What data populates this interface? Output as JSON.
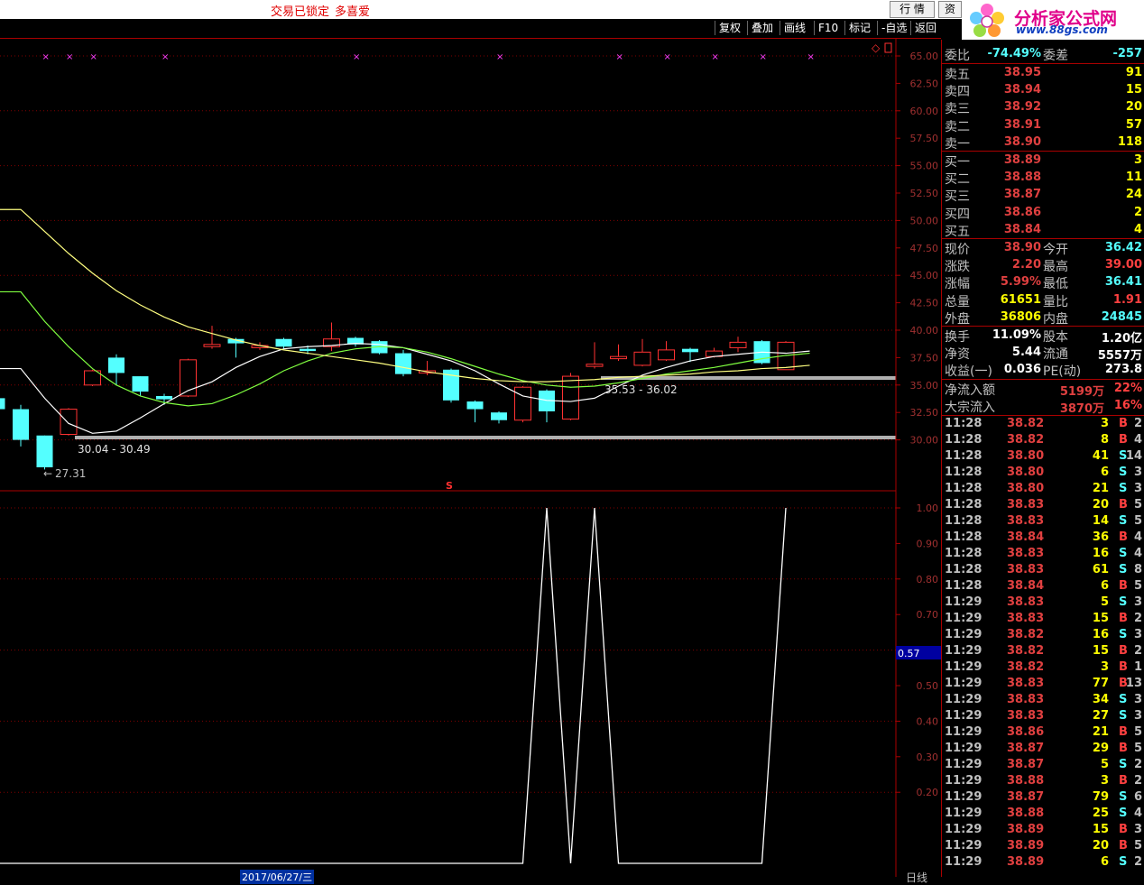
{
  "topbar": {
    "lock_text": "交易已锁定",
    "user_text": "多喜爱",
    "btn_quote": "行 情",
    "btn_info": "资"
  },
  "logo": {
    "title": "分析家公式网",
    "url": "www.88gs.com"
  },
  "toolbar": [
    "复权",
    "叠加",
    "画线",
    "F10",
    "标记",
    "-自选",
    "返回"
  ],
  "chart": {
    "price_ticks": [
      "65.00",
      "62.50",
      "60.00",
      "57.50",
      "55.00",
      "52.50",
      "50.00",
      "47.50",
      "45.00",
      "42.50",
      "40.00",
      "37.50",
      "35.00",
      "32.50",
      "30.00"
    ],
    "indicator_ticks": [
      "1.00",
      "0.90",
      "0.80",
      "0.70",
      "0.60",
      "0.50",
      "0.40",
      "0.30",
      "0.20"
    ],
    "indicator_current": "0.57",
    "annot_low": "27.31",
    "annot_range1": "30.04 - 30.49",
    "annot_range2": "35.53 - 36.02",
    "marker_s": "S",
    "bottom_date": "2017/06/27/三",
    "bottom_label": "日线",
    "colors": {
      "up": "#ff3232",
      "down": "#54ffff",
      "ma_white": "#ffffff",
      "ma_yellow": "#ffff80",
      "ma_green": "#80ff40",
      "grid": "#800000"
    }
  },
  "quote": {
    "wei_bi_label": "委比",
    "wei_bi": "-74.49%",
    "wei_cha_label": "委差",
    "wei_cha": "-257",
    "asks": [
      {
        "label": "卖五",
        "price": "38.95",
        "vol": "91"
      },
      {
        "label": "卖四",
        "price": "38.94",
        "vol": "15"
      },
      {
        "label": "卖三",
        "price": "38.92",
        "vol": "20"
      },
      {
        "label": "卖二",
        "price": "38.91",
        "vol": "57"
      },
      {
        "label": "卖一",
        "price": "38.90",
        "vol": "118"
      }
    ],
    "bids": [
      {
        "label": "买一",
        "price": "38.89",
        "vol": "3"
      },
      {
        "label": "买二",
        "price": "38.88",
        "vol": "11"
      },
      {
        "label": "买三",
        "price": "38.87",
        "vol": "24"
      },
      {
        "label": "买四",
        "price": "38.86",
        "vol": "2"
      },
      {
        "label": "买五",
        "price": "38.84",
        "vol": "4"
      }
    ],
    "stats1": [
      {
        "l1": "现价",
        "v1": "38.90",
        "l2": "今开",
        "v2": "36.42",
        "c2": "#54ffff"
      },
      {
        "l1": "涨跌",
        "v1": "2.20",
        "l2": "最高",
        "v2": "39.00",
        "c2": "#ff4040"
      },
      {
        "l1": "涨幅",
        "v1": "5.99%",
        "l2": "最低",
        "v2": "36.41",
        "c2": "#54ffff"
      },
      {
        "l1": "总量",
        "v1": "61651",
        "l2": "量比",
        "v2": "1.91",
        "c2": "#ff4040",
        "c1": "#ffff00"
      },
      {
        "l1": "外盘",
        "v1": "36806",
        "l2": "内盘",
        "v2": "24845",
        "c2": "#54ffff",
        "c1": "#ffff00"
      }
    ],
    "stats2": [
      {
        "l1": "换手",
        "v1": "11.09%",
        "l2": "股本",
        "v2": "1.20亿"
      },
      {
        "l1": "净资",
        "v1": "5.44",
        "l2": "流通",
        "v2": "5557万"
      },
      {
        "l1": "收益(一)",
        "v1": "0.036",
        "l2": "PE(动)",
        "v2": "273.8"
      }
    ],
    "flow": [
      {
        "label": "净流入额",
        "value": "5199万",
        "pct": "22%"
      },
      {
        "label": "大宗流入",
        "value": "3870万",
        "pct": "16%"
      }
    ]
  },
  "ticks": [
    [
      "11:28",
      "38.82",
      "3",
      "B",
      "2"
    ],
    [
      "11:28",
      "38.82",
      "8",
      "B",
      "4"
    ],
    [
      "11:28",
      "38.80",
      "41",
      "S",
      "14"
    ],
    [
      "11:28",
      "38.80",
      "6",
      "S",
      "3"
    ],
    [
      "11:28",
      "38.80",
      "21",
      "S",
      "3"
    ],
    [
      "11:28",
      "38.83",
      "20",
      "B",
      "5"
    ],
    [
      "11:28",
      "38.83",
      "14",
      "S",
      "5"
    ],
    [
      "11:28",
      "38.84",
      "36",
      "B",
      "4"
    ],
    [
      "11:28",
      "38.83",
      "16",
      "S",
      "4"
    ],
    [
      "11:28",
      "38.83",
      "61",
      "S",
      "8"
    ],
    [
      "11:28",
      "38.84",
      "6",
      "B",
      "5"
    ],
    [
      "11:29",
      "38.83",
      "5",
      "S",
      "3"
    ],
    [
      "11:29",
      "38.83",
      "15",
      "B",
      "2"
    ],
    [
      "11:29",
      "38.82",
      "16",
      "S",
      "3"
    ],
    [
      "11:29",
      "38.82",
      "15",
      "B",
      "2"
    ],
    [
      "11:29",
      "38.82",
      "3",
      "B",
      "1"
    ],
    [
      "11:29",
      "38.83",
      "77",
      "B",
      "13"
    ],
    [
      "11:29",
      "38.83",
      "34",
      "S",
      "3"
    ],
    [
      "11:29",
      "38.83",
      "27",
      "S",
      "3"
    ],
    [
      "11:29",
      "38.86",
      "21",
      "B",
      "5"
    ],
    [
      "11:29",
      "38.87",
      "29",
      "B",
      "5"
    ],
    [
      "11:29",
      "38.87",
      "5",
      "S",
      "2"
    ],
    [
      "11:29",
      "38.88",
      "3",
      "B",
      "2"
    ],
    [
      "11:29",
      "38.87",
      "79",
      "S",
      "6"
    ],
    [
      "11:29",
      "38.88",
      "25",
      "S",
      "4"
    ],
    [
      "11:29",
      "38.89",
      "15",
      "B",
      "3"
    ],
    [
      "11:29",
      "38.89",
      "20",
      "B",
      "5"
    ],
    [
      "11:29",
      "38.89",
      "6",
      "S",
      "2"
    ]
  ],
  "candles": [
    {
      "o": 33.8,
      "c": 32.8,
      "h": 34.0,
      "l": 32.5
    },
    {
      "o": 32.8,
      "c": 30.0,
      "h": 33.2,
      "l": 29.4
    },
    {
      "o": 30.4,
      "c": 27.5,
      "h": 30.4,
      "l": 27.3
    },
    {
      "o": 30.5,
      "c": 32.8,
      "h": 32.9,
      "l": 30.4
    },
    {
      "o": 35.0,
      "c": 36.3,
      "h": 36.4,
      "l": 34.9
    },
    {
      "o": 37.5,
      "c": 36.1,
      "h": 37.8,
      "l": 35.0
    },
    {
      "o": 35.8,
      "c": 34.4,
      "h": 35.8,
      "l": 34.0
    },
    {
      "o": 34.0,
      "c": 33.7,
      "h": 34.2,
      "l": 33.2
    },
    {
      "o": 34.0,
      "c": 37.3,
      "h": 37.4,
      "l": 33.9
    },
    {
      "o": 38.5,
      "c": 38.7,
      "h": 40.4,
      "l": 38.3
    },
    {
      "o": 39.2,
      "c": 38.8,
      "h": 39.3,
      "l": 37.5
    },
    {
      "o": 38.4,
      "c": 38.6,
      "h": 38.9,
      "l": 38.2
    },
    {
      "o": 39.2,
      "c": 38.5,
      "h": 39.3,
      "l": 38.3
    },
    {
      "o": 38.3,
      "c": 38.1,
      "h": 38.6,
      "l": 37.8
    },
    {
      "o": 38.5,
      "c": 39.2,
      "h": 40.7,
      "l": 38.1
    },
    {
      "o": 39.3,
      "c": 38.7,
      "h": 39.4,
      "l": 38.5
    },
    {
      "o": 39.0,
      "c": 37.9,
      "h": 39.1,
      "l": 37.8
    },
    {
      "o": 37.9,
      "c": 36.0,
      "h": 38.2,
      "l": 35.8
    },
    {
      "o": 36.1,
      "c": 36.3,
      "h": 37.2,
      "l": 35.9
    },
    {
      "o": 36.4,
      "c": 33.6,
      "h": 36.5,
      "l": 33.4
    },
    {
      "o": 33.5,
      "c": 32.8,
      "h": 33.6,
      "l": 31.6
    },
    {
      "o": 32.5,
      "c": 31.8,
      "h": 32.6,
      "l": 31.5
    },
    {
      "o": 31.8,
      "c": 34.8,
      "h": 34.9,
      "l": 31.6
    },
    {
      "o": 34.5,
      "c": 32.6,
      "h": 34.6,
      "l": 31.6
    },
    {
      "o": 31.9,
      "c": 35.8,
      "h": 36.1,
      "l": 31.8
    },
    {
      "o": 36.7,
      "c": 36.9,
      "h": 38.9,
      "l": 36.5
    },
    {
      "o": 37.4,
      "c": 37.6,
      "h": 38.7,
      "l": 37.2
    },
    {
      "o": 36.8,
      "c": 38.0,
      "h": 39.2,
      "l": 36.7
    },
    {
      "o": 37.3,
      "c": 38.2,
      "h": 39.0,
      "l": 37.2
    },
    {
      "o": 38.3,
      "c": 38.0,
      "h": 38.4,
      "l": 37.1
    },
    {
      "o": 37.6,
      "c": 38.1,
      "h": 38.4,
      "l": 37.5
    },
    {
      "o": 38.4,
      "c": 38.9,
      "h": 39.4,
      "l": 38.0
    },
    {
      "o": 39.0,
      "c": 37.0,
      "h": 39.1,
      "l": 36.9
    },
    {
      "o": 36.4,
      "c": 38.9,
      "h": 39.0,
      "l": 36.4
    }
  ],
  "ma1": [
    36.5,
    33.8,
    31.5,
    30.6,
    30.8,
    32.0,
    33.3,
    34.5,
    35.3,
    36.6,
    37.6,
    38.3,
    38.5,
    38.6,
    38.8,
    38.7,
    38.4,
    37.8,
    37.2,
    36.3,
    35.1,
    34.0,
    33.6,
    33.5,
    33.8,
    34.9,
    35.9,
    36.6,
    37.2,
    37.6,
    37.8,
    38.0,
    37.9,
    38.1
  ],
  "ma2": [
    43.5,
    40.8,
    38.5,
    36.5,
    35.0,
    34.0,
    33.4,
    33.1,
    33.3,
    34.1,
    35.1,
    36.3,
    37.2,
    37.9,
    38.3,
    38.5,
    38.4,
    38.0,
    37.4,
    36.7,
    36.0,
    35.4,
    35.0,
    34.8,
    34.9,
    35.2,
    35.6,
    36.0,
    36.3,
    36.6,
    37.0,
    37.4,
    37.7,
    37.9
  ],
  "ma3": [
    51.0,
    49.0,
    47.0,
    45.2,
    43.6,
    42.3,
    41.2,
    40.3,
    39.7,
    39.1,
    38.6,
    38.2,
    37.9,
    37.6,
    37.3,
    37.0,
    36.6,
    36.2,
    35.9,
    35.6,
    35.4,
    35.3,
    35.3,
    35.4,
    35.5,
    35.7,
    35.8,
    35.9,
    36.0,
    36.2,
    36.3,
    36.5,
    36.6,
    36.8
  ],
  "indicator": [
    0,
    0,
    0,
    0,
    0,
    0,
    0,
    0,
    0,
    0,
    0,
    0,
    0,
    0,
    0,
    0,
    0,
    0,
    0,
    0,
    0,
    0,
    0,
    1,
    0,
    1,
    0,
    0,
    0,
    0,
    0,
    0,
    0,
    1
  ],
  "x_markers": [
    2,
    3,
    4,
    7,
    15,
    21,
    26,
    28,
    30,
    32,
    34
  ]
}
